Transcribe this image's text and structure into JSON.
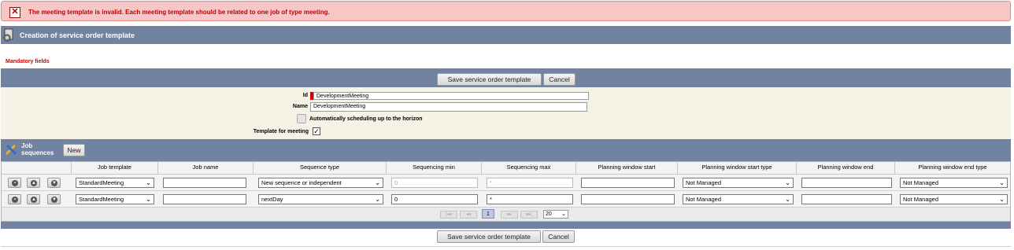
{
  "error": {
    "message": "The meeting template is invalid. Each meeting template should be related to one job of type meeting."
  },
  "header": {
    "title": "Creation of service order template"
  },
  "mandatory_label": "Mandatory fields",
  "actions": {
    "save_label": "Save service order template",
    "cancel_label": "Cancel"
  },
  "form": {
    "id_label": "Id",
    "id_value": "DevelopmentMeeting",
    "name_label": "Name",
    "name_value": "DevelopmentMeeting",
    "auto_label": "Automatically scheduling up to the horizon",
    "auto_checked": false,
    "template_label": "Template for meeting",
    "template_checked": true
  },
  "job_sequences": {
    "title_line1": "Job",
    "title_line2": "sequences",
    "new_label": "New"
  },
  "table": {
    "columns": [
      "Job template",
      "Job name",
      "Sequence type",
      "Sequencing min",
      "Sequencing max",
      "Planning window start",
      "Planning window start type",
      "Planning window end",
      "Planning window end type"
    ],
    "rows": [
      {
        "job_template": "StandardMeeting",
        "job_name": "",
        "sequence_type": "New sequence or independent",
        "seq_min": "0",
        "seq_max": "*",
        "pw_start": "",
        "pw_start_type": "Not Managed",
        "pw_end": "",
        "pw_end_type": "Not Managed",
        "min_disabled": true
      },
      {
        "job_template": "StandardMeeting",
        "job_name": "",
        "sequence_type": "nextDay",
        "seq_min": "0",
        "seq_max": "*",
        "pw_start": "",
        "pw_start_type": "Not Managed",
        "pw_end": "",
        "pw_end_type": "Not Managed",
        "min_disabled": false
      }
    ]
  },
  "pagination": {
    "first": "|◂◂",
    "prev": "◂◂",
    "current": "1",
    "next": "▸▸",
    "last": "▸▸|",
    "page_size": "20"
  },
  "colors": {
    "header_bg": "#7282a1",
    "error_bg": "#f7c6c6",
    "error_text": "#c00000",
    "form_bg": "#f5f2e6"
  },
  "icons": {
    "error": "close-box-icon",
    "header": "document-gear-icon",
    "job_sequences": "tools-icon",
    "row_delete": "trash-icon",
    "row_up": "arrow-up-icon",
    "row_down": "arrow-down-icon"
  }
}
